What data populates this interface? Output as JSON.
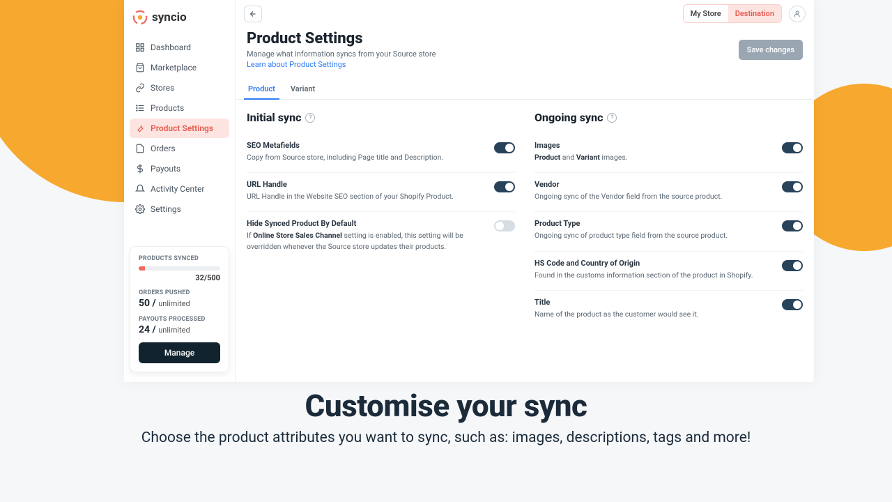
{
  "brand": {
    "name": "syncio"
  },
  "sidebar": {
    "items": [
      {
        "label": "Dashboard"
      },
      {
        "label": "Marketplace"
      },
      {
        "label": "Stores"
      },
      {
        "label": "Products"
      },
      {
        "label": "Product Settings"
      },
      {
        "label": "Orders"
      },
      {
        "label": "Payouts"
      },
      {
        "label": "Activity Center"
      },
      {
        "label": "Settings"
      }
    ],
    "stats": {
      "synced_label": "PRODUCTS SYNCED",
      "synced_value": "32/500",
      "orders_label": "ORDERS PUSHED",
      "orders_value": "50 /",
      "orders_unl": "unlimited",
      "payouts_label": "PAYOUTS PROCESSED",
      "payouts_value": "24 /",
      "payouts_unl": "unlimited",
      "manage": "Manage"
    }
  },
  "topbar": {
    "chip_a": "My Store",
    "chip_b": "Destination"
  },
  "page": {
    "title": "Product Settings",
    "sub": "Manage what information syncs from your Source store",
    "link": "Learn about Product Settings",
    "save": "Save changes"
  },
  "tabs": {
    "a": "Product",
    "b": "Variant"
  },
  "colA": {
    "heading": "Initial sync",
    "items": [
      {
        "title": "SEO Metafields",
        "desc": "Copy from Source store, including Page title and Description.",
        "on": true
      },
      {
        "title": "URL Handle",
        "desc": "URL Handle in the Website SEO section of your Shopify Product.",
        "on": true
      },
      {
        "title": "Hide Synced Product By Default",
        "desc_pre": "If ",
        "desc_bold": "Online Store Sales Channel",
        "desc_post": " setting is enabled, this setting will be overridden whenever the Source store updates their products.",
        "on": false
      }
    ]
  },
  "colB": {
    "heading": "Ongoing sync",
    "items": [
      {
        "title": "Images",
        "desc_pre": "",
        "desc_b1": "Product",
        "desc_mid": " and ",
        "desc_b2": "Variant",
        "desc_post": " images.",
        "on": true
      },
      {
        "title": "Vendor",
        "desc": "Ongoing sync of the Vendor field from the source product.",
        "on": true
      },
      {
        "title": "Product Type",
        "desc": "Ongoing sync of product type field from the source product.",
        "on": true
      },
      {
        "title": "HS Code and Country of Origin",
        "desc": "Found in the customs information section of the product in Shopify.",
        "on": true
      },
      {
        "title": "Title",
        "desc": "Name of the product as the customer would see it.",
        "on": true
      }
    ]
  },
  "promo": {
    "h": "Customise your sync",
    "p": "Choose the product attributes you want to sync, such as: images, descriptions, tags and more!"
  }
}
